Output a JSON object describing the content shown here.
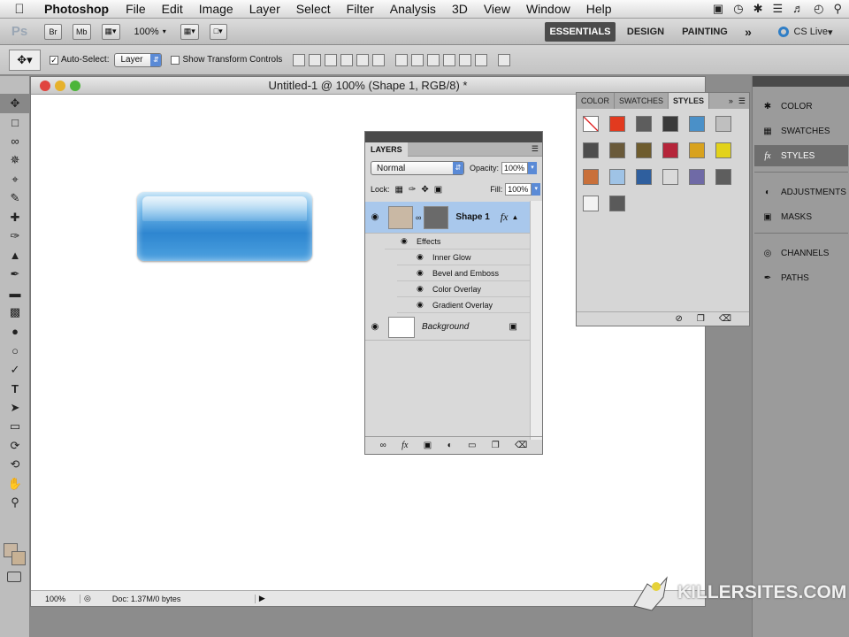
{
  "menubar": {
    "app_name": "Photoshop",
    "items": [
      "File",
      "Edit",
      "Image",
      "Layer",
      "Select",
      "Filter",
      "Analysis",
      "3D",
      "View",
      "Window",
      "Help"
    ]
  },
  "appbar": {
    "logo": "Ps",
    "bridge_label": "Br",
    "minibridge_label": "Mb",
    "zoom": "100%",
    "workspaces": {
      "essentials": "ESSENTIALS",
      "design": "DESIGN",
      "painting": "PAINTING",
      "more": "»"
    },
    "cs_live": "CS Live"
  },
  "options": {
    "auto_select_label": "Auto-Select:",
    "auto_select_value": "Layer",
    "show_transform_label": "Show Transform Controls"
  },
  "document": {
    "title": "Untitled-1 @ 100% (Shape 1, RGB/8) *",
    "status_zoom": "100%",
    "status_doc": "Doc: 1.37M/0 bytes"
  },
  "layers_panel": {
    "tab": "LAYERS",
    "blend_mode": "Normal",
    "opacity_label": "Opacity:",
    "opacity_value": "100%",
    "lock_label": "Lock:",
    "fill_label": "Fill:",
    "fill_value": "100%",
    "layers": [
      {
        "name": "Shape 1",
        "fx": "fx"
      },
      {
        "name": "Background"
      }
    ],
    "effects_label": "Effects",
    "effects": [
      "Inner Glow",
      "Bevel and Emboss",
      "Color Overlay",
      "Gradient Overlay"
    ]
  },
  "styles_panel": {
    "tabs": [
      "COLOR",
      "SWATCHES",
      "STYLES"
    ],
    "active_tab": "STYLES",
    "swatch_colors": [
      "#ffffff",
      "#e23a1f",
      "#5d5d5d",
      "#3a3a3a",
      "#4a90c8",
      "#bfbfbf",
      "#4d4d4d",
      "#6a5a3a",
      "#6e5c2e",
      "#b5253a",
      "#d8a21e",
      "#e2d21a",
      "#c9703a",
      "#9fc3e6",
      "#2f5f9e",
      "#dadada",
      "#6f6aa6",
      "#5e5e5e",
      "#f2f2f2",
      "#5a5a5a"
    ]
  },
  "dock": {
    "items": [
      "COLOR",
      "SWATCHES",
      "STYLES",
      "ADJUSTMENTS",
      "MASKS",
      "CHANNELS",
      "PATHS"
    ],
    "active": "STYLES"
  },
  "watermark": "KILLERSITES.COM"
}
